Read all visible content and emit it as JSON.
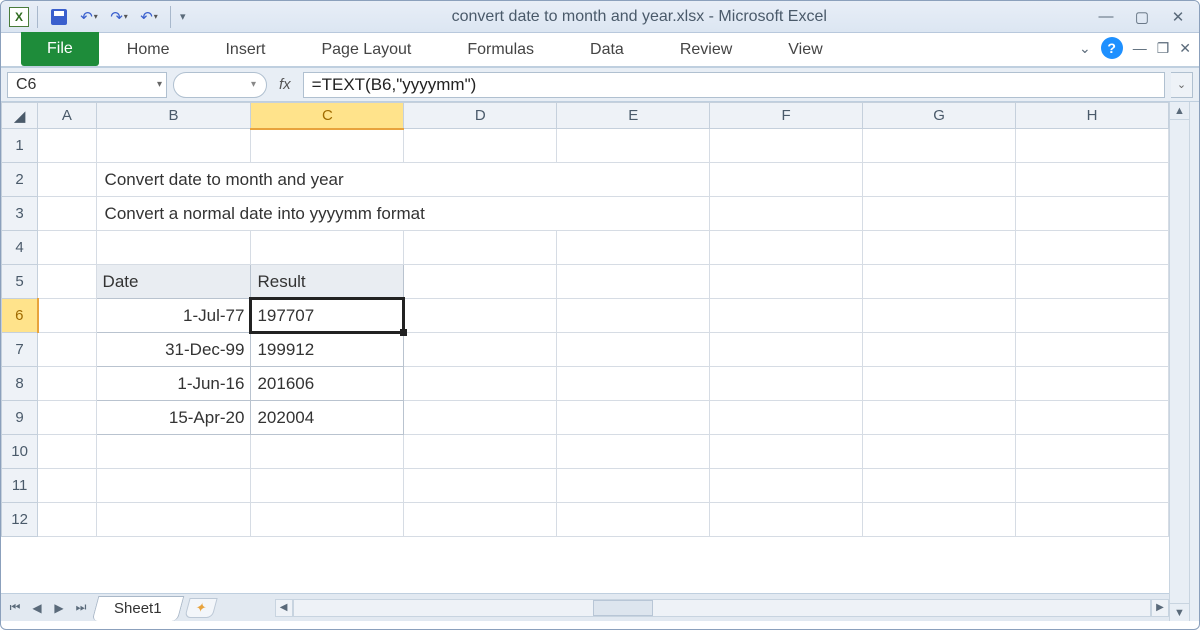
{
  "window": {
    "title": "convert date to month and year.xlsx - Microsoft Excel"
  },
  "ribbon": {
    "file": "File",
    "tabs": [
      "Home",
      "Insert",
      "Page Layout",
      "Formulas",
      "Data",
      "Review",
      "View"
    ]
  },
  "nameBox": "C6",
  "fxLabel": "fx",
  "formula": "=TEXT(B6,\"yyyymm\")",
  "columns": [
    "A",
    "B",
    "C",
    "D",
    "E",
    "F",
    "G",
    "H"
  ],
  "rows": [
    "1",
    "2",
    "3",
    "4",
    "5",
    "6",
    "7",
    "8",
    "9",
    "10",
    "11",
    "12"
  ],
  "activeCol": "C",
  "activeRow": "6",
  "content": {
    "title": "Convert date to month and year",
    "subtitle": "Convert a normal date into yyyymm format",
    "headers": {
      "b": "Date",
      "c": "Result"
    },
    "data": [
      {
        "date": "1-Jul-77",
        "result": "197707"
      },
      {
        "date": "31-Dec-99",
        "result": "199912"
      },
      {
        "date": "1-Jun-16",
        "result": "201606"
      },
      {
        "date": "15-Apr-20",
        "result": "202004"
      }
    ]
  },
  "sheetTab": "Sheet1"
}
